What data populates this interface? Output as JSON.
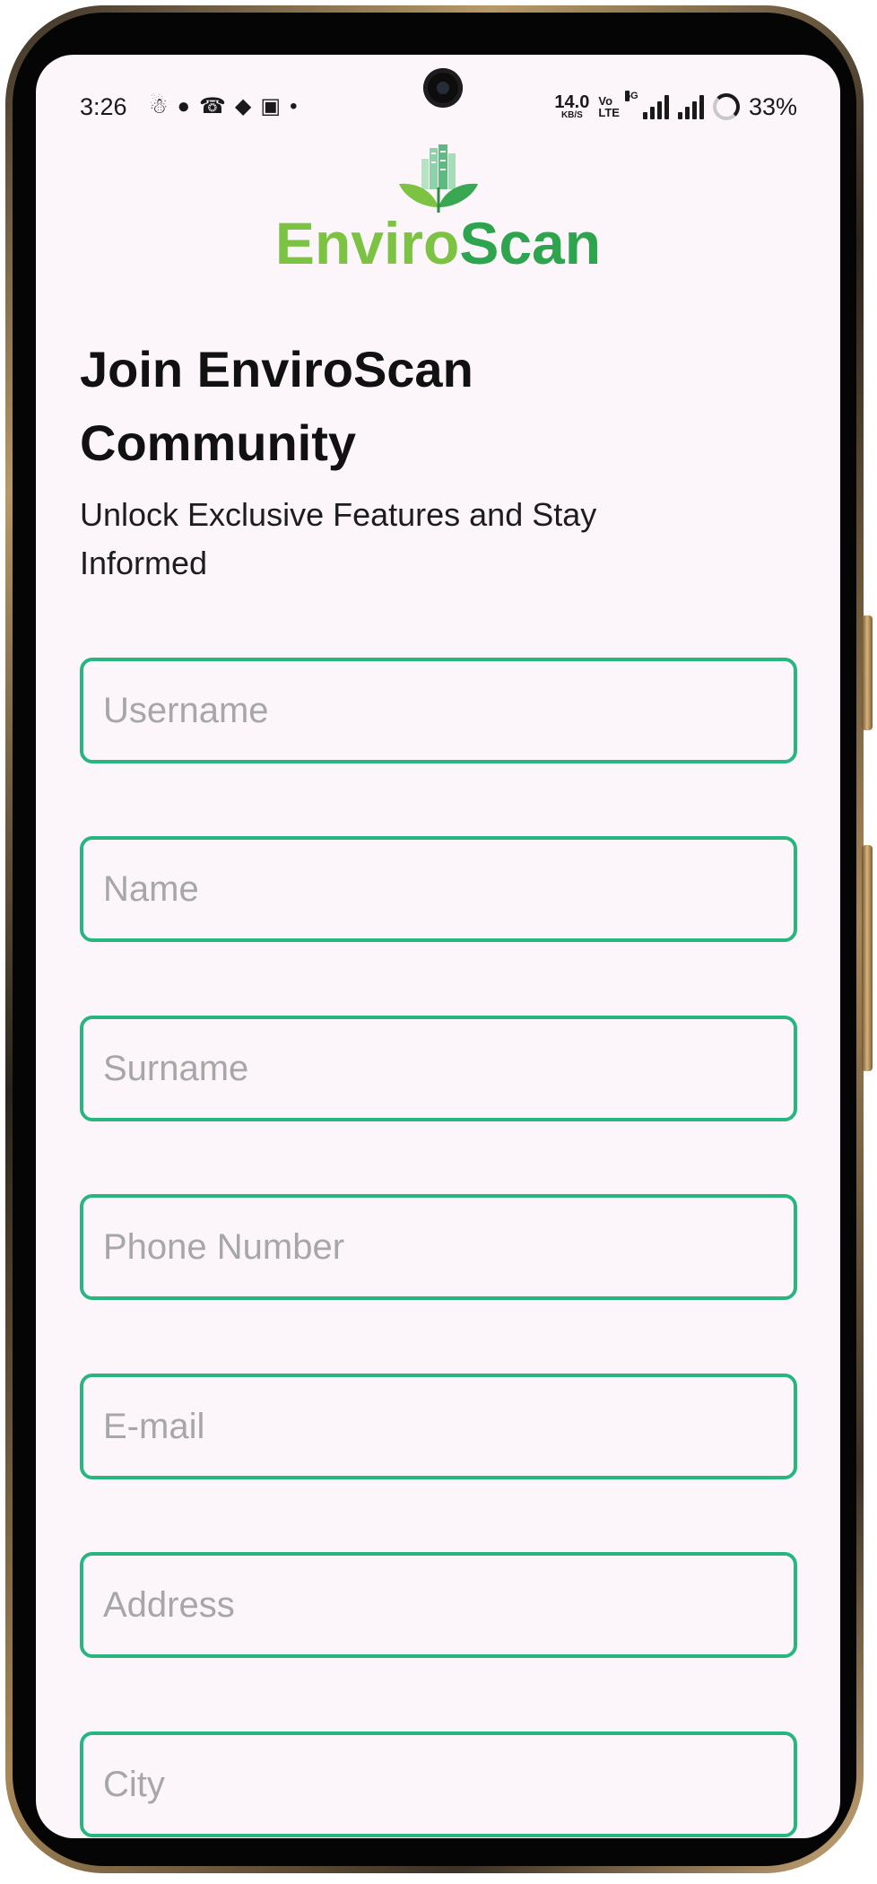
{
  "status_bar": {
    "time": "3:26",
    "net_speed": "14.0",
    "net_speed_unit": "KB/S",
    "volte_top": "Vo",
    "volte_bottom": "LTE",
    "network": "5G",
    "battery": "33%"
  },
  "logo": {
    "part1": "Enviro",
    "part2": "Scan"
  },
  "header": {
    "title": "Join EnviroScan Community",
    "subtitle": "Unlock Exclusive Features and Stay Informed"
  },
  "form": {
    "username": {
      "placeholder": "Username",
      "value": ""
    },
    "name": {
      "placeholder": "Name",
      "value": ""
    },
    "surname": {
      "placeholder": "Surname",
      "value": ""
    },
    "phone": {
      "placeholder": "Phone Number",
      "value": ""
    },
    "email": {
      "placeholder": "E-mail",
      "value": ""
    },
    "address": {
      "placeholder": "Address",
      "value": ""
    },
    "city": {
      "placeholder": "City",
      "value": ""
    }
  },
  "colors": {
    "accent": "#27b680",
    "logo_light_green": "#7cc243",
    "logo_dark_green": "#2ea44f",
    "background": "#fcf6fb"
  }
}
